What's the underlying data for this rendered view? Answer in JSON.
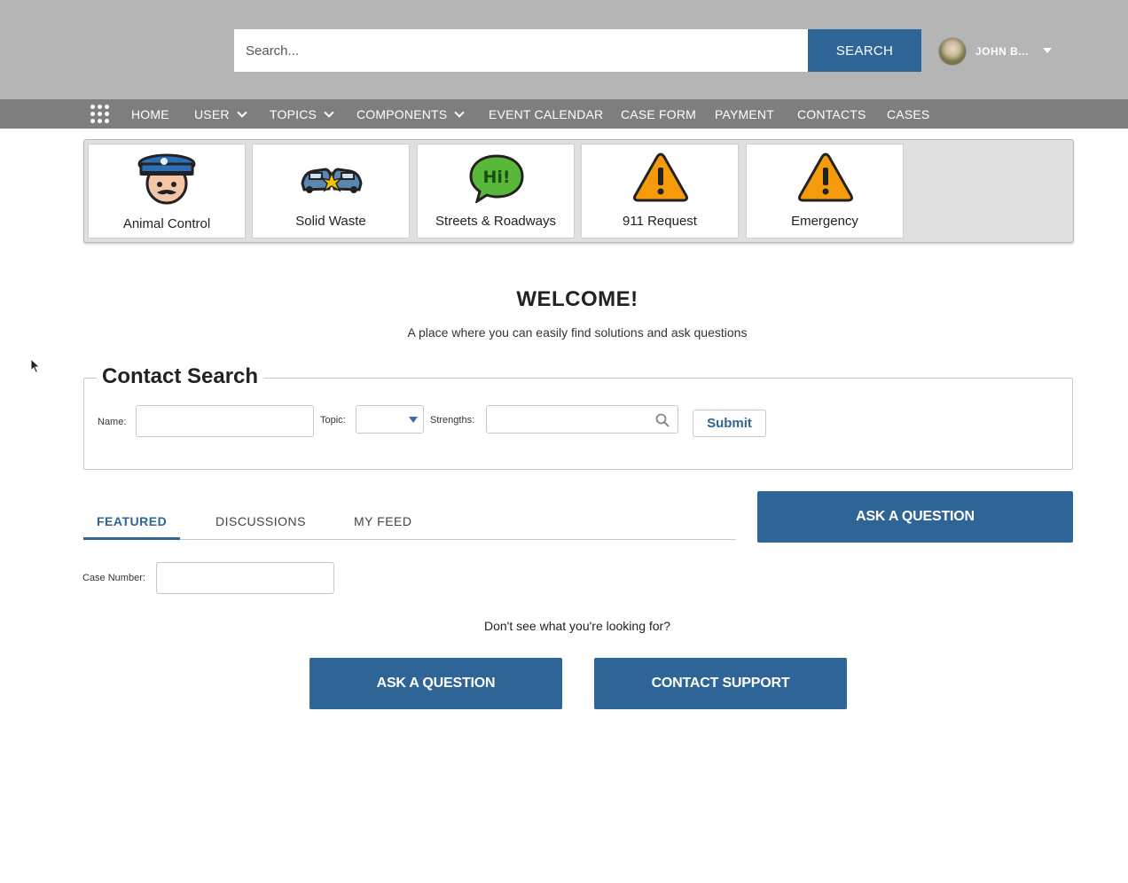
{
  "header": {
    "search_placeholder": "Search...",
    "search_button": "SEARCH",
    "user_name": "JOHN B...",
    "accent_color": "#2e6496"
  },
  "nav": {
    "items": [
      {
        "label": "HOME",
        "has_dropdown": false
      },
      {
        "label": "USER",
        "has_dropdown": true
      },
      {
        "label": "TOPICS",
        "has_dropdown": true
      },
      {
        "label": "COMPONENTS",
        "has_dropdown": true
      },
      {
        "label": "EVENT CALENDAR",
        "has_dropdown": false
      },
      {
        "label": "CASE FORM",
        "has_dropdown": false
      },
      {
        "label": "PAYMENT",
        "has_dropdown": false
      },
      {
        "label": "CONTACTS",
        "has_dropdown": false
      },
      {
        "label": "CASES",
        "has_dropdown": false
      }
    ]
  },
  "tiles": [
    {
      "label": "Animal Control",
      "icon": "police-officer-icon"
    },
    {
      "label": "Solid Waste",
      "icon": "car-crash-icon"
    },
    {
      "label": "Streets & Roadways",
      "icon": "speech-bubble-hi-icon"
    },
    {
      "label": "911 Request",
      "icon": "warning-icon"
    },
    {
      "label": "Emergency",
      "icon": "warning-icon"
    }
  ],
  "welcome": {
    "title": "WELCOME!",
    "subtitle": "A place where you can easily find solutions and ask questions"
  },
  "contact_search": {
    "legend": "Contact Search",
    "name_label": "Name:",
    "name_value": "",
    "topic_label": "Topic:",
    "topic_value": "",
    "strengths_label": "Strengths:",
    "strengths_value": "",
    "submit_label": "Submit"
  },
  "tabs": [
    {
      "label": "FEATURED",
      "active": true
    },
    {
      "label": "DISCUSSIONS",
      "active": false
    },
    {
      "label": "MY FEED",
      "active": false
    }
  ],
  "ask_question_top": "ASK A QUESTION",
  "case_number": {
    "label": "Case Number:",
    "value": ""
  },
  "help": {
    "prompt": "Don't see what you're looking for?",
    "ask_button": "ASK A QUESTION",
    "contact_button": "CONTACT SUPPORT"
  }
}
